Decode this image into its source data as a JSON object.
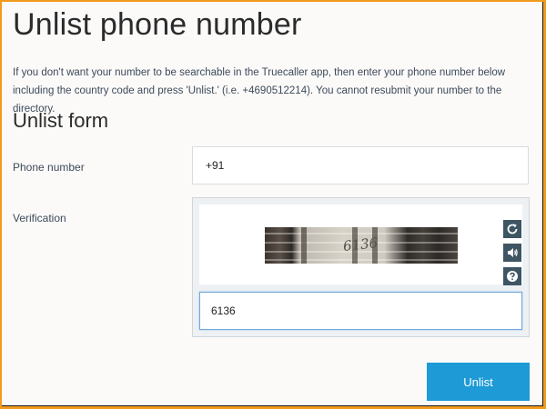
{
  "page": {
    "title": "Unlist phone number",
    "description": "If you don't want your number to be searchable in the Truecaller app, then enter your phone number below including the country code and press 'Unlist.' (i.e. +4690512214). You cannot resubmit your number to the directory.",
    "form_title": "Unlist form"
  },
  "phone": {
    "label": "Phone number",
    "value": "+91"
  },
  "verification": {
    "label": "Verification",
    "captcha_text": "6136",
    "input_value": "6136",
    "buttons": [
      {
        "icon": "refresh-icon"
      },
      {
        "icon": "audio-icon"
      },
      {
        "icon": "help-icon"
      }
    ]
  },
  "actions": {
    "submit_label": "Unlist"
  },
  "colors": {
    "accent": "#1e9ad6",
    "border_highlight": "#f29a1c",
    "captcha_button": "#3e5563"
  }
}
